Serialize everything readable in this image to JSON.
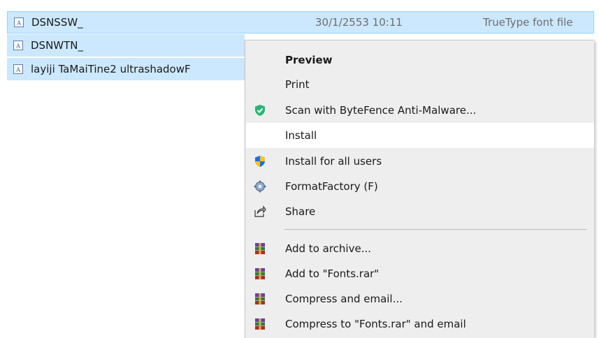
{
  "files": [
    {
      "name": "DSNSSW_",
      "date": "30/1/2553 10:11",
      "type": "TrueType font file",
      "icon": "font-file-icon"
    },
    {
      "name": "DSNWTN_",
      "icon": "font-file-icon"
    },
    {
      "name": "layiji TaMaiTine2 ultrashadowF",
      "icon": "font-file-icon"
    }
  ],
  "context_menu": {
    "items": [
      {
        "label": "Preview",
        "bold": true,
        "icon": ""
      },
      {
        "label": "Print",
        "icon": ""
      },
      {
        "label": "Scan with ByteFence Anti-Malware...",
        "icon": "bytefence-shield-icon"
      },
      {
        "label": "Install",
        "highlighted": true,
        "icon": ""
      },
      {
        "label": "Install for all users",
        "icon": "uac-shield-icon"
      },
      {
        "label": "FormatFactory (F)",
        "icon": "formatfactory-icon"
      },
      {
        "label": "Share",
        "icon": "share-icon"
      },
      {
        "label": "Add to archive...",
        "icon": "winrar-icon"
      },
      {
        "label": "Add to \"Fonts.rar\"",
        "icon": "winrar-icon"
      },
      {
        "label": "Compress and email...",
        "icon": "winrar-icon"
      },
      {
        "label": "Compress to \"Fonts.rar\" and email",
        "icon": "winrar-icon"
      }
    ]
  },
  "colors": {
    "selection_bg": "#cce8ff",
    "selection_border": "#99d1ff",
    "menu_bg": "#eeeeee",
    "menu_highlight": "#ffffff",
    "bytefence_green": "#2bb673",
    "uac_blue": "#1e6fd9",
    "uac_yellow": "#f7c325"
  }
}
